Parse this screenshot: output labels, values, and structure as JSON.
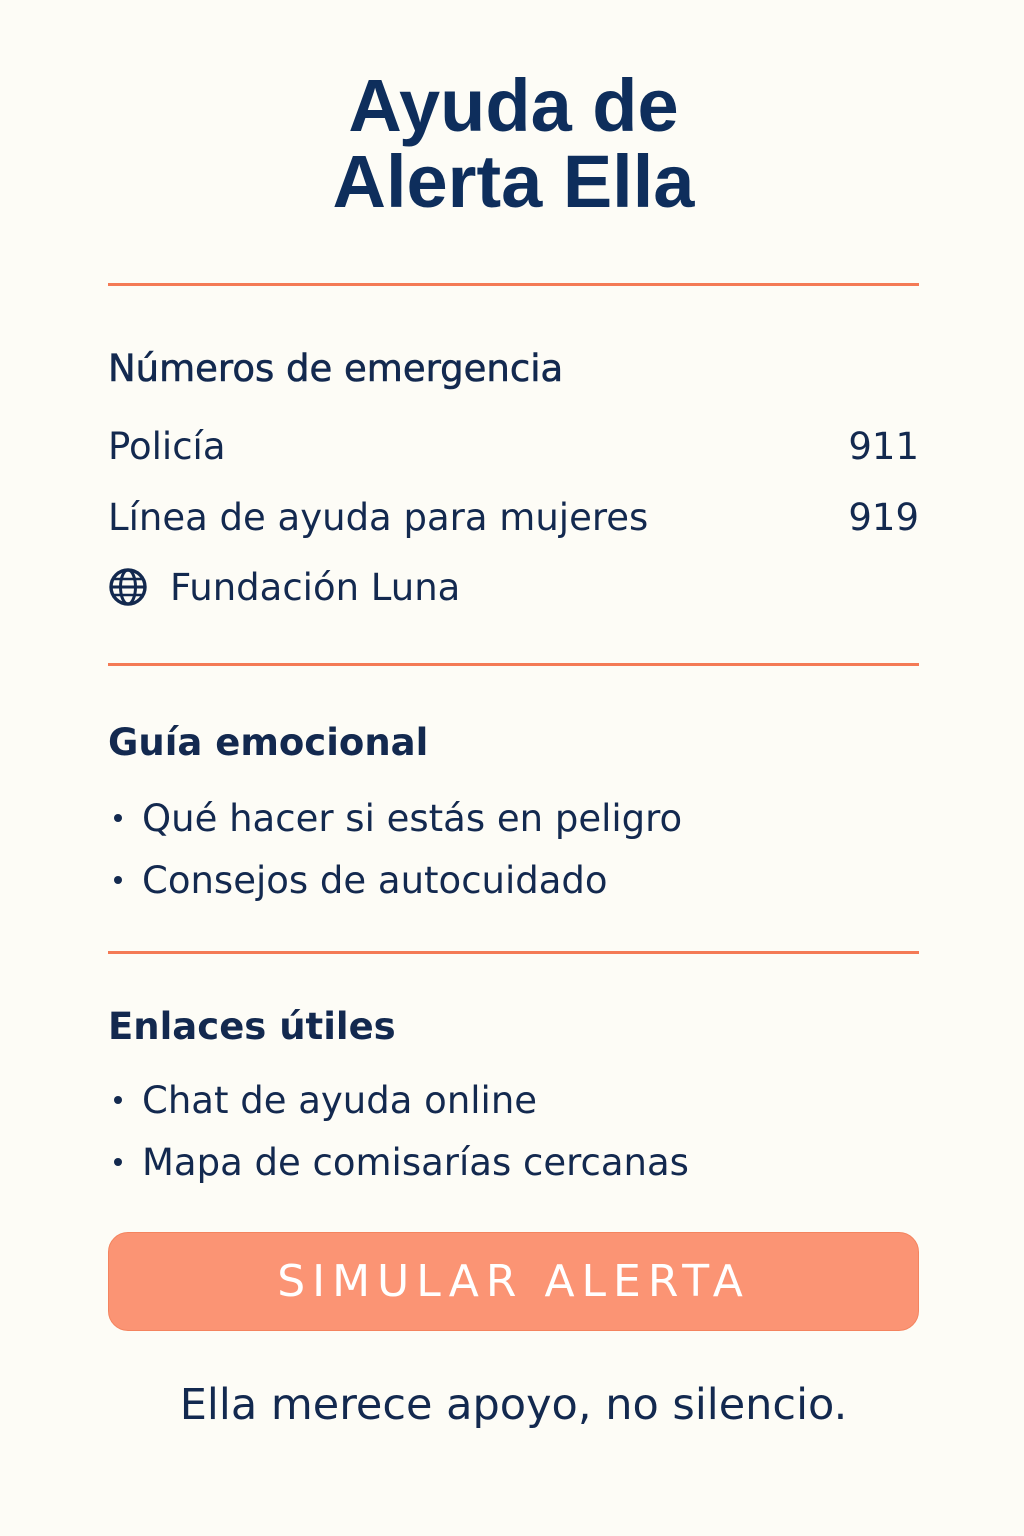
{
  "header": {
    "title_line1": "Ayuda de",
    "title_line2": "Alerta Ella"
  },
  "emergency": {
    "heading": "Números de emergencia",
    "rows": [
      {
        "label": "Policía",
        "value": "911"
      },
      {
        "label": "Línea de ayuda para mujeres",
        "value": "919"
      }
    ],
    "foundation": {
      "icon": "globe-icon",
      "label": "Fundación Luna"
    }
  },
  "emotional_guide": {
    "heading": "Guía emocional",
    "items": [
      "Qué hacer si estás en peligro",
      "Consejos de autocuidado"
    ]
  },
  "useful_links": {
    "heading": "Enlaces útiles",
    "items": [
      "Chat de ayuda online",
      "Mapa de comisarías cercanas"
    ]
  },
  "cta": {
    "label": "SIMULAR ALERTA"
  },
  "footer": {
    "tagline": "Ella merece apoyo, no silencio."
  },
  "colors": {
    "background": "#fdfcf6",
    "title": "#0e2e5c",
    "text": "#13294f",
    "divider": "#f47a55",
    "button": "#fb9474"
  }
}
